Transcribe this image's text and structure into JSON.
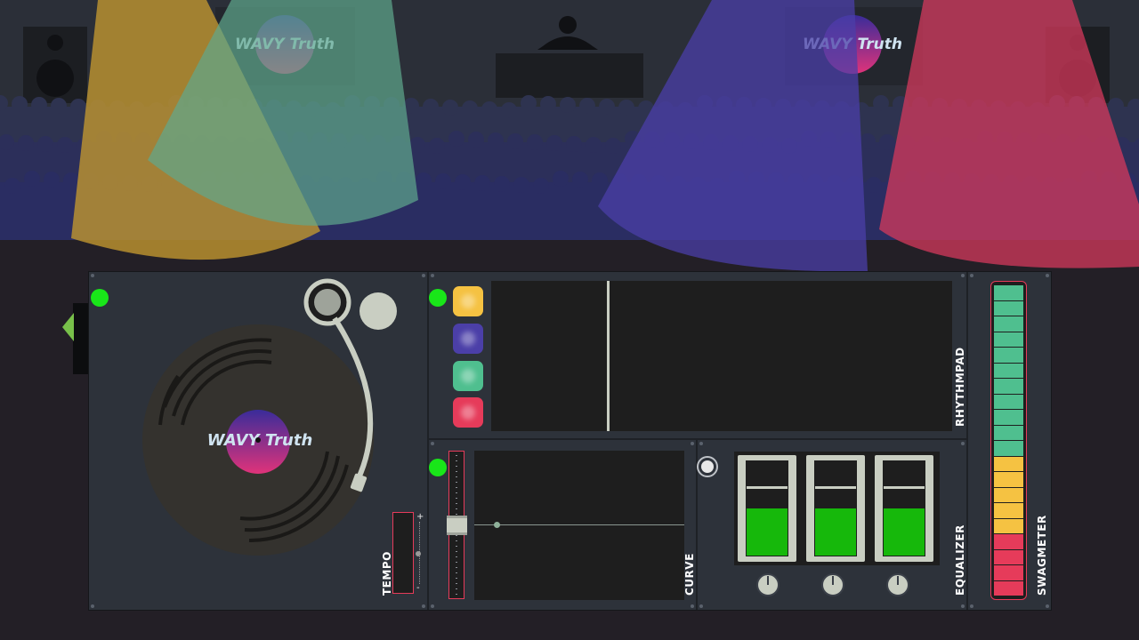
{
  "scene": {
    "banner_logo": "WAVY Truth",
    "record_logo": "WAVY Truth"
  },
  "labels": {
    "tempo": "TEMPO",
    "rhythmpad": "RHYTHMPAD",
    "curve": "CURVE",
    "equalizer": "EQUALIZER",
    "swagmeter": "SWAGMETER",
    "tempo_plus": "+",
    "tempo_minus": "-"
  },
  "colors": {
    "led_on": "#19e619",
    "pad_yellow": "#f5c242",
    "pad_purple": "#4b3fa8",
    "pad_green": "#4fbf8f",
    "pad_red": "#e63b5a",
    "eq_fill": "#16b80b",
    "swag_green": "#4fbf8f",
    "swag_yellow": "#f5c242",
    "swag_red": "#e63b5a"
  },
  "equalizer": {
    "levels": [
      0.5,
      0.5,
      0.5
    ]
  },
  "swagmeter": {
    "segments": [
      "green",
      "green",
      "green",
      "green",
      "green",
      "green",
      "green",
      "green",
      "green",
      "green",
      "green",
      "yellow",
      "yellow",
      "yellow",
      "yellow",
      "yellow",
      "red",
      "red",
      "red",
      "red"
    ]
  },
  "curve": {
    "level": 0.5
  },
  "tempo": {
    "level": 0.5
  }
}
